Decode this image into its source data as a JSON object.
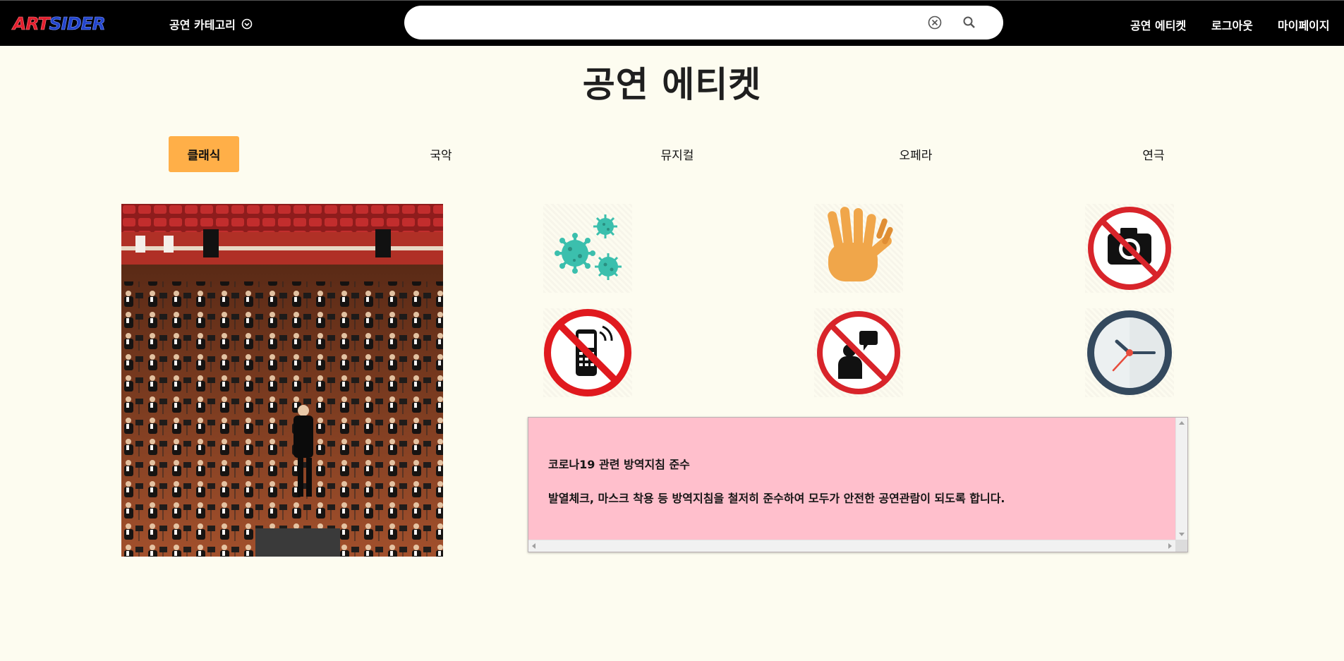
{
  "header": {
    "logo_prefix": "ART",
    "logo_suffix": "SIDER",
    "category_label": "공연 카테고리",
    "search": {
      "value": "",
      "placeholder": ""
    },
    "nav": {
      "etiquette": "공연 에티켓",
      "logout": "로그아웃",
      "mypage": "마이페이지"
    }
  },
  "page": {
    "title": "공연 에티켓"
  },
  "tabs": [
    {
      "label": "클래식",
      "active": true
    },
    {
      "label": "국악",
      "active": false
    },
    {
      "label": "뮤지컬",
      "active": false
    },
    {
      "label": "오페라",
      "active": false
    },
    {
      "label": "연극",
      "active": false
    }
  ],
  "icons": [
    "virus-icon",
    "clapping-hands-icon",
    "no-camera-icon",
    "no-phone-icon",
    "no-talking-icon",
    "clock-icon"
  ],
  "info": {
    "heading": "코로나19 관련 방역지침 준수",
    "body": "발열체크, 마스크 착용 등 방역지침을 철저히 준수하여 모두가 안전한 공연관람이 되도록 합니다."
  },
  "colors": {
    "nav_bg": "#000000",
    "page_bg": "#fdfcf0",
    "active_tab": "#ffaf48",
    "info_bg": "#ffbfcc",
    "prohibit_red": "#d8242a"
  }
}
